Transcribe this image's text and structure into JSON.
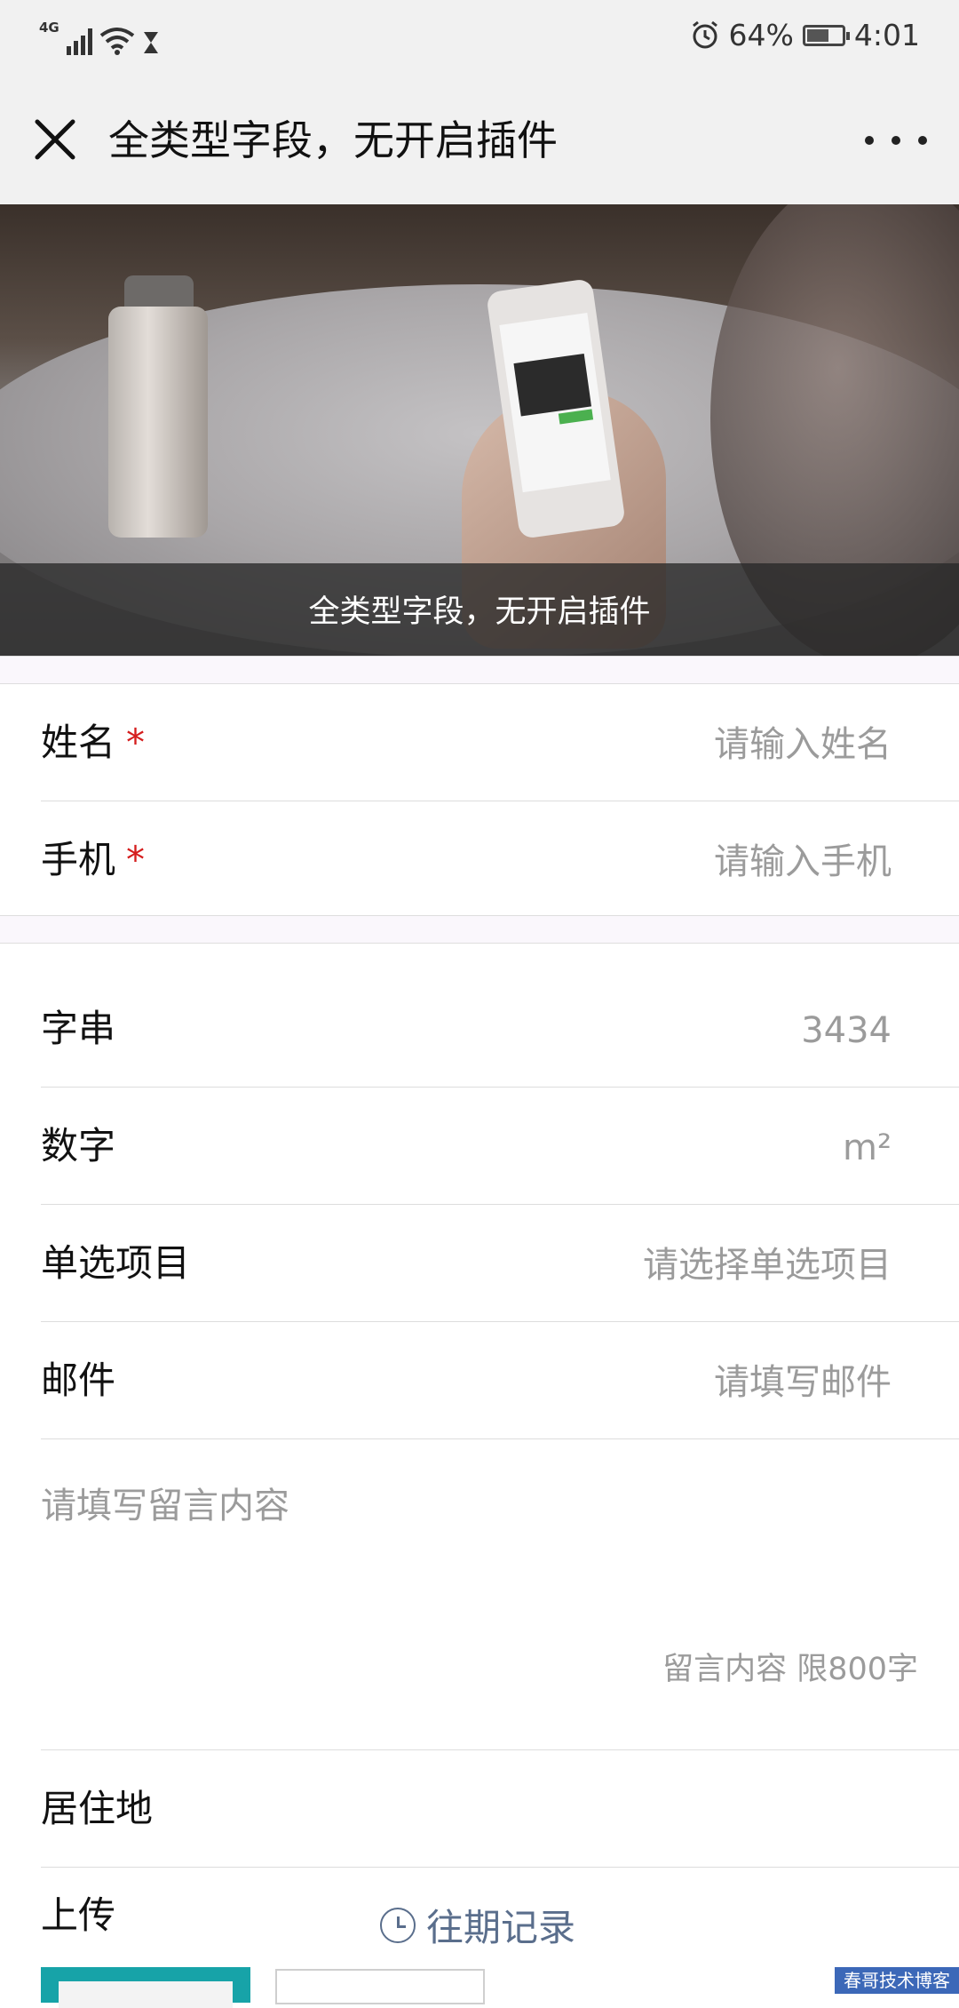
{
  "status_bar": {
    "signal_label": "4G",
    "battery_percent": "64%",
    "battery_level": 0.64,
    "time": "4:01",
    "icons": [
      "signal-icon",
      "wifi-icon",
      "hourglass-icon",
      "alarm-icon",
      "battery-icon"
    ]
  },
  "nav": {
    "title": "全类型字段，无开启插件",
    "close_icon": "close-icon",
    "more_icon": "more-icon"
  },
  "banner": {
    "caption": "全类型字段，无开启插件"
  },
  "form": {
    "required_mark": "*",
    "name": {
      "label": "姓名",
      "placeholder": "请输入姓名"
    },
    "phone": {
      "label": "手机",
      "placeholder": "请输入手机"
    },
    "string_field": {
      "label": "字串",
      "value": "3434"
    },
    "number_field": {
      "label": "数字",
      "unit": "m²"
    },
    "single_select": {
      "label": "单选项目",
      "placeholder": "请选择单选项目"
    },
    "email": {
      "label": "邮件",
      "placeholder": "请填写邮件"
    },
    "message": {
      "placeholder": "请填写留言内容",
      "limit_hint": "留言内容 限800字"
    },
    "residence": {
      "label": "居住地"
    },
    "upload": {
      "label": "上传"
    }
  },
  "history_link": {
    "label": "往期记录",
    "icon": "clock-icon"
  },
  "watermark": "春哥技术博客"
}
